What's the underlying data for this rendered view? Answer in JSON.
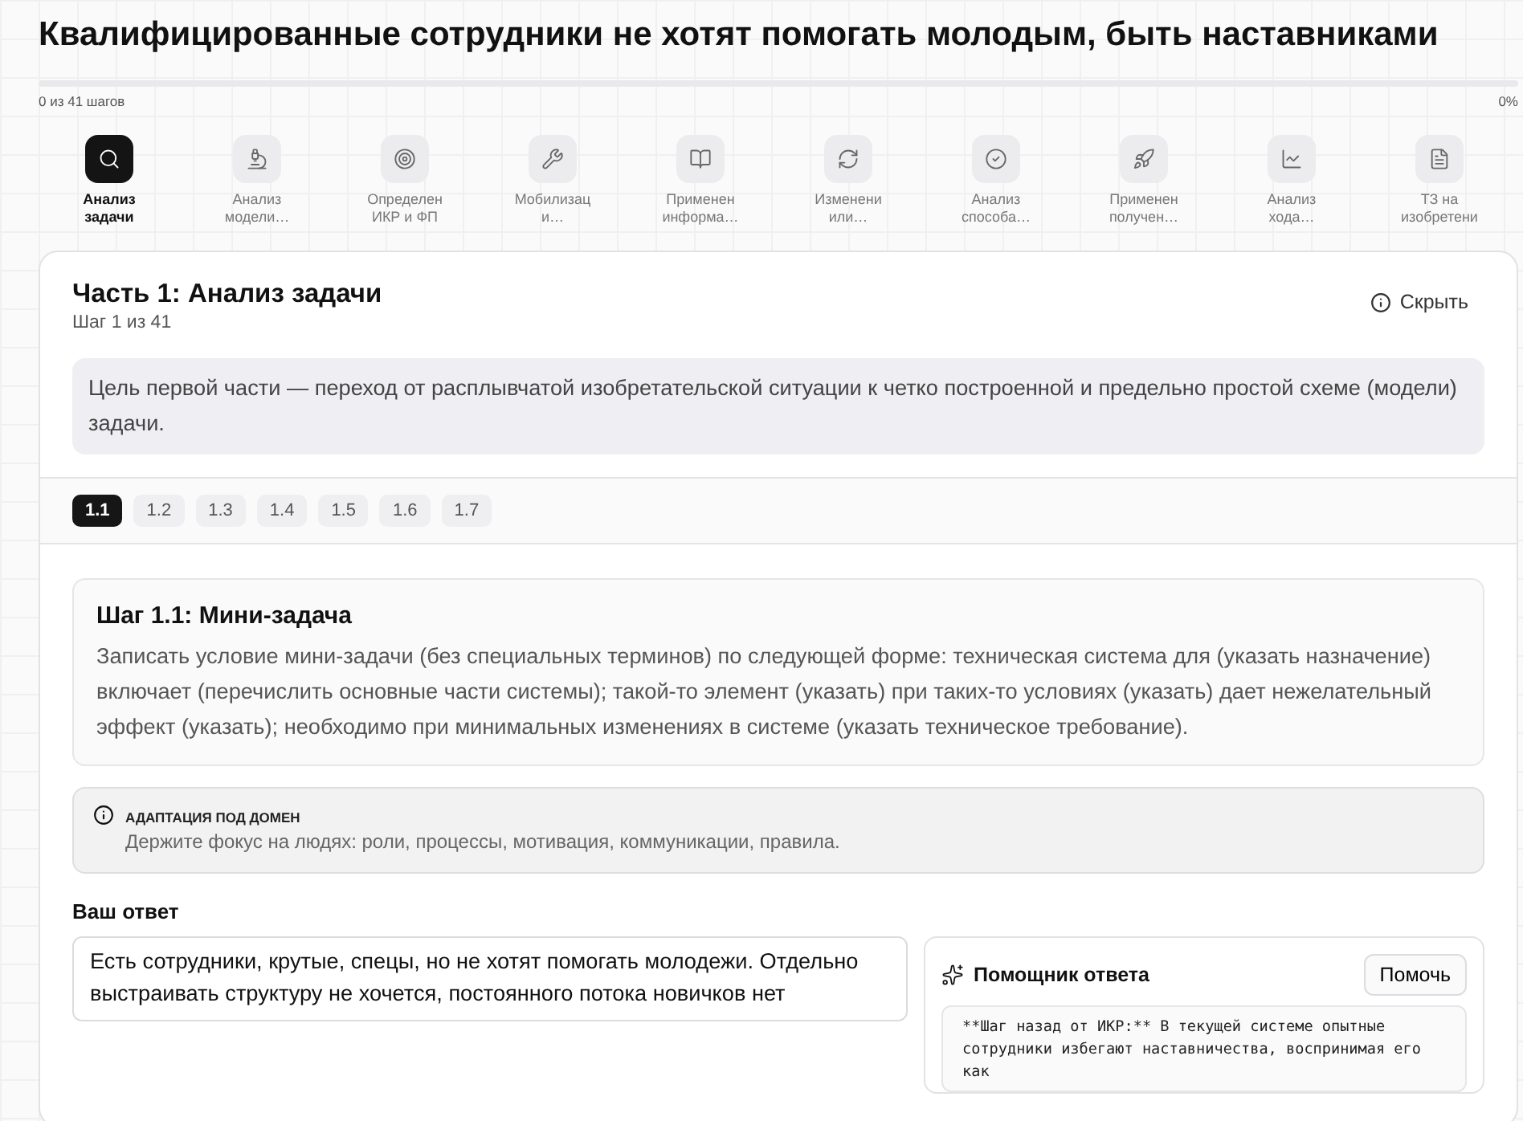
{
  "title": "Квалифицированные сотрудники не хотят помогать молодым, быть наставниками",
  "progress": {
    "level": 0,
    "steps_label": "0 из 41 шагов",
    "percent": "0%"
  },
  "stages": [
    {
      "label_lines": [
        "Анализ",
        "задачи"
      ],
      "selected": true
    },
    {
      "label_lines": [
        "Анализ",
        "модели…"
      ],
      "selected": false
    },
    {
      "label_lines": [
        "Определен",
        "ИКР и ФП"
      ],
      "selected": false
    },
    {
      "label_lines": [
        "Мобилизац",
        "и…"
      ],
      "selected": false
    },
    {
      "label_lines": [
        "Применен",
        "информа…"
      ],
      "selected": false
    },
    {
      "label_lines": [
        "Изменени",
        "или…"
      ],
      "selected": false
    },
    {
      "label_lines": [
        "Анализ",
        "способа…"
      ],
      "selected": false
    },
    {
      "label_lines": [
        "Применен",
        "получен…"
      ],
      "selected": false
    },
    {
      "label_lines": [
        "Анализ",
        "хода…"
      ],
      "selected": false
    },
    {
      "label_lines": [
        "ТЗ на",
        "изобретени"
      ],
      "selected": false
    }
  ],
  "part": {
    "title": "Часть 1: Анализ задачи",
    "subtitle": "Шаг 1 из 41",
    "hide_button": "Скрыть",
    "goal": "Цель первой части — переход от расплывчатой изобретательской ситуации к четко построенной и предельно простой схеме (модели) задачи."
  },
  "substeps": [
    {
      "label": "1.1",
      "selected": true
    },
    {
      "label": "1.2",
      "selected": false
    },
    {
      "label": "1.3",
      "selected": false
    },
    {
      "label": "1.4",
      "selected": false
    },
    {
      "label": "1.5",
      "selected": false
    },
    {
      "label": "1.6",
      "selected": false
    },
    {
      "label": "1.7",
      "selected": false
    }
  ],
  "step": {
    "title": "Шаг 1.1: Мини-задача",
    "description": "Записать условие мини-задачи (без специальных терминов) по следующей форме: техническая система для (указать назначение) включает (перечислить основные части системы); такой-то элемент (указать) при таких-то условиях (указать) дает нежелательный эффект (указать); необходимо при минимальных изменениях в системе (указать техническое требование)."
  },
  "domain_note": {
    "title": "АДАПТАЦИЯ ПОД ДОМЕН",
    "text": "Держите фокус на людях: роли, процессы, мотивация, коммуникации, правила."
  },
  "answer": {
    "label": "Ваш ответ",
    "value": "Есть сотрудники, крутые, спецы, но не хотят помогать молодежи. Отдельно выстраивать структуру не хочется, постоянного потока новичков нет"
  },
  "assistant": {
    "title": "Помощник ответа",
    "button": "Помочь",
    "output": "**Шаг назад от ИКР:** В текущей системе опытные сотрудники избегают наставничества, воспринимая его как"
  }
}
